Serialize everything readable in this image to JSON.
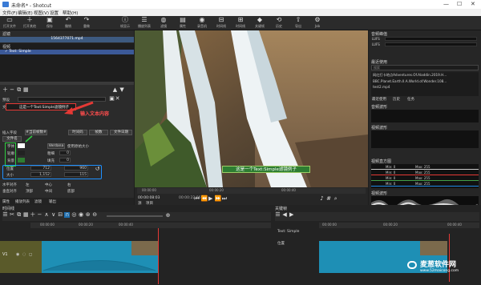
{
  "window": {
    "title": "未命名* - Shotcut",
    "controls": [
      "—",
      "☐",
      "✕"
    ]
  },
  "menu": [
    "文件(F)",
    "编辑(E)",
    "视图(V)",
    "设置",
    "帮助(H)"
  ],
  "toolbar": [
    {
      "label": "打开文件",
      "icon": "folder-icon"
    },
    {
      "label": "打开其他",
      "icon": "plus-icon"
    },
    {
      "label": "保存",
      "icon": "save-icon"
    },
    {
      "label": "撤销",
      "icon": "undo-icon"
    },
    {
      "label": "重做",
      "icon": "redo-icon"
    },
    {
      "label": "帧显示",
      "icon": "info-icon"
    },
    {
      "label": "播放列表",
      "icon": "list-icon"
    },
    {
      "label": "滤镜",
      "icon": "filter-icon"
    },
    {
      "label": "属性",
      "icon": "properties-icon"
    },
    {
      "label": "录音机",
      "icon": "record-icon"
    },
    {
      "label": "时间线",
      "icon": "timeline-icon"
    },
    {
      "label": "时间线",
      "icon": "timeline2-icon"
    },
    {
      "label": "关键帧",
      "icon": "keyframe-icon"
    },
    {
      "label": "历史",
      "icon": "history-icon"
    },
    {
      "label": "导出",
      "icon": "export-icon"
    },
    {
      "label": "Job",
      "icon": "job-icon"
    }
  ],
  "filters": {
    "title": "滤镜",
    "clip_label": "1564377071.mp4",
    "section": "视频",
    "item": "✓ Text: Simple",
    "preset_label": "预设",
    "text_label": "文本",
    "text_value": "这是一个Text:Simple滤镜例子",
    "annotation": "输入文本内容",
    "insert_field": "插入字段",
    "insert_value": "#当前帧数#",
    "tab_timecode": "时间码",
    "tab_frames": "帧数",
    "tab_filedate": "文件日期",
    "tab_filename": "文件名",
    "font_label": "字体",
    "font_value": "Verdana",
    "autosize": "使用原始大小",
    "outline_label": "轮廓",
    "thick_label": "粗细",
    "thick_value": "0",
    "bg_label": "背景",
    "pad_label": "填充",
    "pad_value": "0",
    "pos_label": "位置",
    "pos_x": "712",
    "pos_y": "960",
    "size_label": "大小",
    "size_w": "1,152",
    "size_h": "115",
    "halign_label": "水平对齐",
    "valign_label": "垂直对齐",
    "halign": [
      "左",
      "中心",
      "右"
    ],
    "valign": [
      "顶部",
      "中间",
      "底部"
    ],
    "bottom_tabs": [
      "属性",
      "播放列表",
      "滤镜",
      "输出"
    ]
  },
  "player": {
    "overlay_text": "这是一个Text:Simple滤镜例子",
    "timecode_current": "00:00:08:03",
    "timecode_total": "00:00:22:06",
    "ruler": [
      "00:00:00",
      "00:00:20",
      "00:00:40"
    ],
    "tabs": [
      "源",
      "项目"
    ]
  },
  "right": {
    "audio_title": "音频峰值",
    "levels": [
      "LUFS",
      "LUFS"
    ],
    "recent_title": "最近使用",
    "recent_placeholder": "搜索",
    "recent_items": [
      "网红打卡地点Adventures.Of.Aladdin.2019.H...",
      "BBC.Planet.Earth.II.A.World.of.Wonder.108...",
      "test2.mp4"
    ],
    "recent_tabs": [
      "最近使用",
      "历史",
      "任务"
    ],
    "waveform_title": "音频波形",
    "spectrum_title": "视频波形",
    "histogram_title": "视频直方图",
    "hist_rows": [
      {
        "label": "Min: 0",
        "mid": "Max: 255",
        "color": "#cccccc"
      },
      {
        "label": "Min: 0",
        "mid": "Max: 255",
        "color": "#e53935"
      },
      {
        "label": "Min: 0",
        "mid": "Max: 255",
        "color": "#43a047"
      },
      {
        "label": "Min: 0",
        "mid": "Max: 255",
        "color": "#1e88e5"
      }
    ],
    "vectorscope_title": "视频波形"
  },
  "timeline": {
    "title": "时间线",
    "ruler": [
      "00:00:00",
      "00:00:20",
      "00:00:40"
    ],
    "track": "V1"
  },
  "keyframes": {
    "title": "关键帧",
    "filter_name": "Text: Simple",
    "param": "位置",
    "ruler": [
      "00:00:00",
      "00:00:20",
      "00:00:40"
    ]
  },
  "watermark": {
    "brand": "麦葱软件网",
    "url": "www.52maicong.com"
  }
}
